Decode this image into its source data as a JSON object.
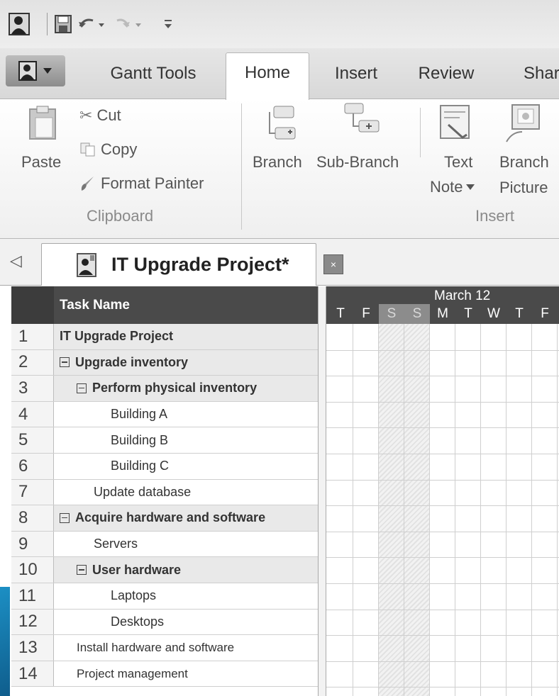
{
  "quick_access": {
    "icons": [
      "app-icon",
      "save-icon",
      "undo-icon",
      "redo-icon",
      "customize-icon"
    ]
  },
  "ribbon_tabs": {
    "gantt_tools": "Gantt Tools",
    "home": "Home",
    "insert": "Insert",
    "review": "Review",
    "share": "Share"
  },
  "clipboard": {
    "paste": "Paste",
    "cut": "Cut",
    "copy": "Copy",
    "format_painter": "Format Painter",
    "group_label": "Clipboard"
  },
  "insert_group": {
    "branch": "Branch",
    "sub_branch": "Sub-Branch",
    "text_note_line1": "Text",
    "text_note_line2": "Note",
    "branch_picture_line1": "Branch",
    "branch_picture_line2": "Picture",
    "group_label": "Insert"
  },
  "document": {
    "nav_arrow": "◁",
    "title": "IT Upgrade Project*",
    "close": "×"
  },
  "table": {
    "header_task_name": "Task Name",
    "rows": [
      {
        "num": "1",
        "name": "IT Upgrade Project"
      },
      {
        "num": "2",
        "name": "Upgrade inventory"
      },
      {
        "num": "3",
        "name": "Perform physical inventory"
      },
      {
        "num": "4",
        "name": "Building A"
      },
      {
        "num": "5",
        "name": "Building B"
      },
      {
        "num": "6",
        "name": "Building C"
      },
      {
        "num": "7",
        "name": "Update database"
      },
      {
        "num": "8",
        "name": "Acquire hardware and software"
      },
      {
        "num": "9",
        "name": "Servers"
      },
      {
        "num": "10",
        "name": "User hardware"
      },
      {
        "num": "11",
        "name": "Laptops"
      },
      {
        "num": "12",
        "name": "Desktops"
      },
      {
        "num": "13",
        "name": "Install hardware and software"
      },
      {
        "num": "14",
        "name": "Project management"
      }
    ]
  },
  "timeline": {
    "month": "March 12",
    "days": [
      "T",
      "F",
      "S",
      "S",
      "M",
      "T",
      "W",
      "T",
      "F"
    ]
  }
}
